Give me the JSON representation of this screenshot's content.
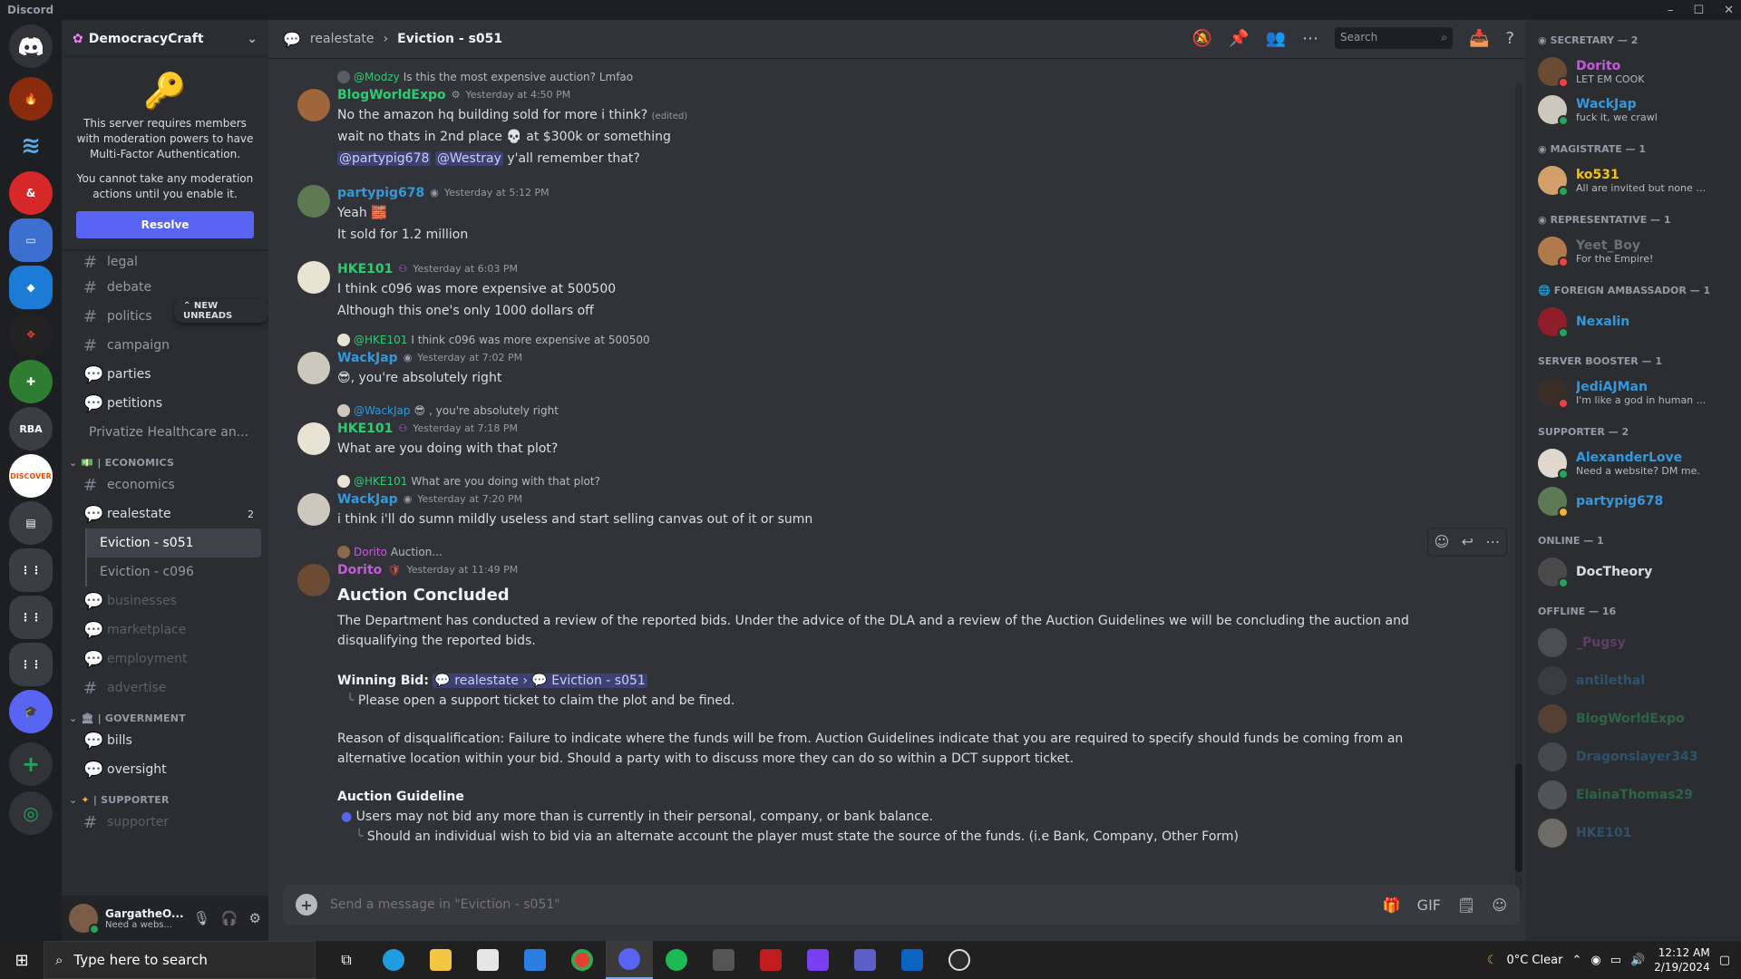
{
  "app": {
    "title": "Discord"
  },
  "server": {
    "name": "DemocracyCraft",
    "mfa_text1": "This server requires members with moderation powers to have Multi-Factor Authentication.",
    "mfa_text2": "You cannot take any moderation actions until you enable it.",
    "resolve_label": "Resolve",
    "new_unreads": "NEW UNREADS"
  },
  "channels": {
    "legal": "legal",
    "debate": "debate",
    "politics": "politics",
    "campaign": "campaign",
    "parties": "parties",
    "petitions": "petitions",
    "petition_thread": "Privatize Healthcare an...",
    "cat_economics": "| ECONOMICS",
    "economics": "economics",
    "realestate": "realestate",
    "realestate_badge": "2",
    "thread1": "Eviction - s051",
    "thread2": "Eviction - c096",
    "businesses": "businesses",
    "marketplace": "marketplace",
    "employment": "employment",
    "advertise": "advertise",
    "cat_government": "| GOVERNMENT",
    "bills": "bills",
    "oversight": "oversight",
    "cat_supporter": "| SUPPORTER",
    "supporter": "supporter"
  },
  "user": {
    "name": "GargatheO...",
    "status": "Need a webs..."
  },
  "header": {
    "parent": "realestate",
    "separator": "›",
    "current": "Eviction - s051",
    "search": "Search"
  },
  "messages": {
    "m1_reply_user": "@Modzy",
    "m1_reply_text": "Is this the most expensive auction? Lmfao",
    "m1_user": "BlogWorldExpo",
    "m1_time": "Yesterday at 4:50 PM",
    "m1_l1": "No the amazon hq building sold for more i think?",
    "m1_edited": "(edited)",
    "m1_l2a": "wait no thats in 2nd place",
    "m1_l2b": "at $300k or something",
    "m1_mention1": "@partypig678",
    "m1_mention2": "@Westray",
    "m1_l3": "y'all remember that?",
    "m2_user": "partypig678",
    "m2_time": "Yesterday at 5:12 PM",
    "m2_l1": "Yeah",
    "m2_l2": "It sold for 1.2 million",
    "m3_user": "HKE101",
    "m3_time": "Yesterday at 6:03 PM",
    "m3_l1": "I think c096 was more expensive at 500500",
    "m3_l2": "Although this one's only 1000 dollars off",
    "m4_reply_user": "@HKE101",
    "m4_reply_text": "I think c096 was more expensive at 500500",
    "m4_user": "WackJap",
    "m4_time": "Yesterday at 7:02 PM",
    "m4_l1": ", you're absolutely right",
    "m5_reply_user": "@WackJap",
    "m5_reply_text": ", you're absolutely right",
    "m5_user": "HKE101",
    "m5_time": "Yesterday at 7:18 PM",
    "m5_l1": "What are you doing with that plot?",
    "m6_reply_user": "@HKE101",
    "m6_reply_text": "What are you doing with that plot?",
    "m6_user": "WackJap",
    "m6_time": "Yesterday at 7:20 PM",
    "m6_l1": "i think i'll do sumn mildly useless and start selling canvas out of it or sumn",
    "m7_reply_user": "Dorito",
    "m7_reply_text": "Auction...",
    "m7_user": "Dorito",
    "m7_time": "Yesterday at 11:49 PM",
    "m7_title": "Auction Concluded",
    "m7_p1": "The Department has conducted a review of the reported bids. Under the advice of the DLA and a review of the Auction Guidelines we will be concluding the auction and disqualifying the reported bids.",
    "m7_winning": "Winning Bid:",
    "m7_link_parent": "realestate",
    "m7_link_thread": "Eviction - s051",
    "m7_sub1": "Please open a support ticket to claim the plot and be fined.",
    "m7_p2": "Reason of disqualification: Failure to indicate where the funds will be from. Auction Guidelines indicate that you are required to specify should funds be coming from an alternative location within your bid. Should a party with to discuss more they can do so within a DCT support ticket.",
    "m7_guideline": "Auction Guideline",
    "m7_bullet1": "Users may not bid any more than is currently in their personal, company, or bank balance.",
    "m7_sub2": "Should an individual wish to bid via an alternate account the player must state the source of the funds. (i.e Bank, Company, Other Form)"
  },
  "composer": {
    "placeholder": "Send a message in \"Eviction - s051\""
  },
  "members": {
    "cat1": "SECRETARY — 2",
    "cat2": "MAGISTRATE — 1",
    "cat3": "REPRESENTATIVE — 1",
    "cat4": "FOREIGN AMBASSADOR — 1",
    "cat5": "SERVER BOOSTER — 1",
    "cat6": "SUPPORTER — 2",
    "cat7": "ONLINE — 1",
    "cat8": "OFFLINE — 16",
    "u1": "Dorito",
    "u1s": "LET EM COOK",
    "u2": "WackJap",
    "u2s": "fuck it, we crawl",
    "u3": "ko531",
    "u3s": "All are invited but none are w...",
    "u4": "Yeet_Boy",
    "u4s": "For the Empire!",
    "u5": "Nexalin",
    "u6": "JediAJMan",
    "u6s": "I'm like a god in human ...",
    "u7": "AlexanderLove",
    "u7s": "Need a website? DM me.",
    "u8": "partypig678",
    "u9": "DocTheory",
    "o1": "_Pugsy",
    "o2": "antilethal",
    "o3": "BlogWorldExpo",
    "o4": "Dragonslayer343",
    "o5": "ElainaThomas29",
    "o6": "HKE101"
  },
  "taskbar": {
    "search": "Type here to search",
    "weather": "0°C  Clear",
    "time": "12:12 AM",
    "date": "2/19/2024"
  },
  "colors": {
    "blurple": "#5865f2",
    "green_name": "#2ecc71",
    "blue_name": "#3498db",
    "orange_name": "#f1c40f",
    "pink_name": "#c55bd8"
  }
}
